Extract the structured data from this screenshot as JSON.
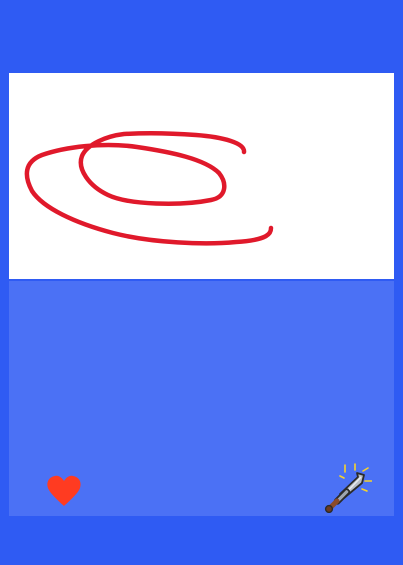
{
  "colors": {
    "background": "#2F5BF3",
    "lower_panel": "#4B71F5",
    "canvas": "#FFFFFF",
    "stroke": "#E0192B",
    "heart": "#FF3B21"
  },
  "icons": {
    "heart": "heart-icon",
    "sword": "sword-icon"
  }
}
